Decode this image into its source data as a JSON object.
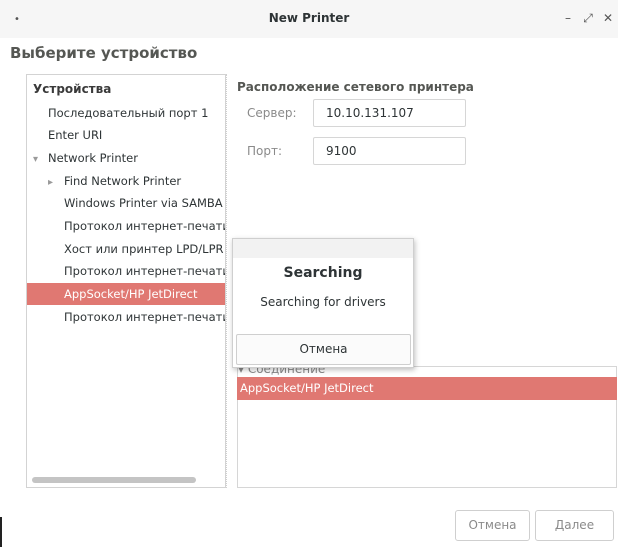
{
  "window": {
    "title": "New Printer",
    "menu_glyph": "•",
    "minimize_glyph": "–",
    "maximize_glyph": "⤢",
    "close_glyph": "✕"
  },
  "header": "Выберите устройство",
  "devices": {
    "heading": "Устройства",
    "items": [
      {
        "label": "Последовательный порт 1"
      },
      {
        "label": "Enter URI"
      },
      {
        "label": "Network Printer",
        "arrow": "▾"
      },
      {
        "label": "Find Network Printer",
        "arrow": "▸"
      },
      {
        "label": "Windows Printer via SAMBA"
      },
      {
        "label": "Протокол интернет-печати (ipp)"
      },
      {
        "label": "Хост или принтер LPD/LPR"
      },
      {
        "label": "Протокол интернет-печати (https)"
      },
      {
        "label": "AppSocket/HP JetDirect"
      },
      {
        "label": "Протокол интернет-печати (ipps)"
      }
    ],
    "selected_index": 8
  },
  "network": {
    "title": "Расположение сетевого принтера",
    "server_label": "Сервер:",
    "server_value": "10.10.131.107",
    "port_label": "Порт:",
    "port_value": "9100"
  },
  "connection": {
    "heading": "▾ Соединение",
    "selected": "AppSocket/HP JetDirect"
  },
  "dialog": {
    "title": "Searching",
    "message": "Searching for drivers",
    "cancel": "Отмена"
  },
  "buttons": {
    "cancel": "Отмена",
    "next": "Далее"
  },
  "colors": {
    "selection": "#e07872",
    "titlebar": "#f6f6f6"
  }
}
